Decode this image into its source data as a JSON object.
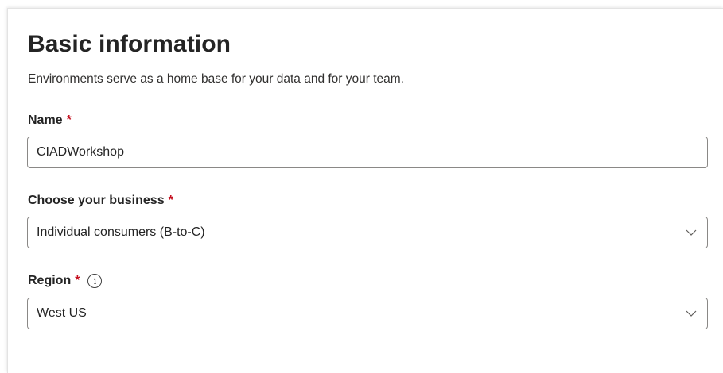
{
  "form": {
    "title": "Basic information",
    "subtitle": "Environments serve as a home base for your data and for your team.",
    "name": {
      "label": "Name",
      "required_marker": "*",
      "value": "CIADWorkshop"
    },
    "business": {
      "label": "Choose your business",
      "required_marker": "*",
      "selected": "Individual consumers (B-to-C)"
    },
    "region": {
      "label": "Region",
      "required_marker": "*",
      "info_icon_glyph": "i",
      "selected": "West US"
    }
  },
  "icons": {
    "info": "info-icon",
    "dropdown": "chevron-down-icon"
  },
  "colors": {
    "required": "#c50f1f",
    "border": "#8a8886",
    "text": "#242424"
  }
}
